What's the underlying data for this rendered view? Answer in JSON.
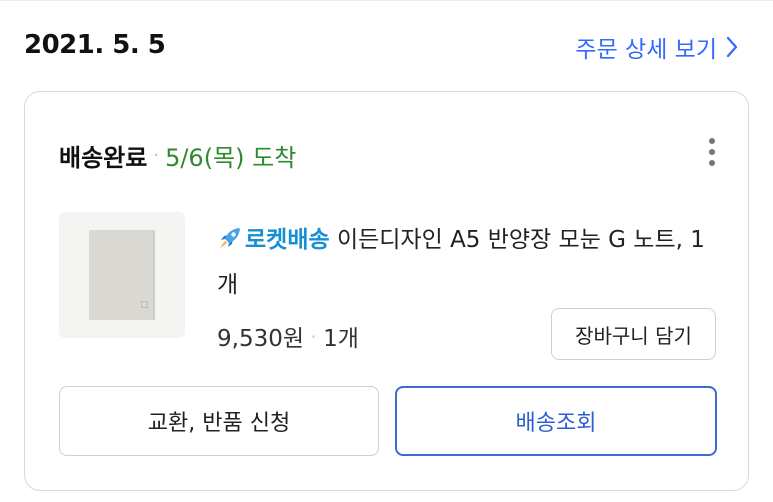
{
  "order": {
    "date": "2021. 5. 5",
    "detail_link_label": "주문 상세 보기",
    "detail_link_icon": "chevron-right-icon"
  },
  "delivery": {
    "status": "배송완료",
    "separator": "·",
    "arrival": "5/6(목) 도착",
    "menu_icon": "more-vertical-icon"
  },
  "product": {
    "badge_icon": "rocket-icon",
    "badge_label": "로켓배송",
    "title": " 이든디자인 A5 반양장 모눈 G 노트, 1개",
    "price": "9,530원",
    "separator": "·",
    "quantity": "1개"
  },
  "actions": {
    "cart_label": "장바구니 담기",
    "return_label": "교환, 반품 신청",
    "track_label": "배송조회"
  },
  "colors": {
    "link": "#346aff",
    "arrival": "#2f8a2f",
    "rocket": "#1590d6",
    "track_border": "#3e6bd1"
  }
}
